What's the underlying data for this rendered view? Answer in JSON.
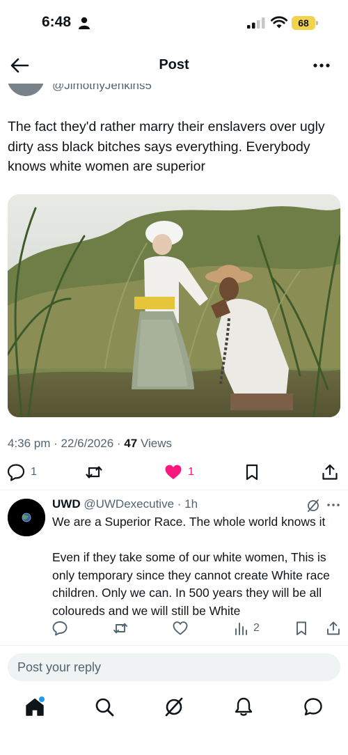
{
  "status_bar": {
    "time": "6:48",
    "battery": "68"
  },
  "header": {
    "title": "Post"
  },
  "post": {
    "author_handle_partial": "@JimothyJenkins5",
    "text": "The fact they'd rather marry their enslavers over ugly dirty ass black bitches says everything. Everybody knows white women are superior",
    "time": "4:36 pm",
    "date": "22/6/2026",
    "views_count": "47",
    "views_label": "Views",
    "replies": "1",
    "likes": "1",
    "liked": true
  },
  "reply": {
    "name": "UWD",
    "handle": "@UWDexecutive",
    "age": "1h",
    "text": "We are a Superior Race. The whole world knows it\n\nEven if they take some of our white women, This is only temporary since they cannot create White race children. Only we can. In 500 years they will be all coloureds and we will still be White",
    "views": "2"
  },
  "compose": {
    "placeholder": "Post your reply"
  },
  "tabbar": {
    "items": [
      {
        "name": "home",
        "icon": "home-icon",
        "active": true
      },
      {
        "name": "search",
        "icon": "search-icon"
      },
      {
        "name": "grok",
        "icon": "grok-icon"
      },
      {
        "name": "notifications",
        "icon": "bell-icon"
      },
      {
        "name": "messages",
        "icon": "message-icon"
      }
    ]
  },
  "colors": {
    "accent": "#1d9bf0",
    "like": "#f91880",
    "text": "#0f1419",
    "muted": "#536471",
    "battery": "#f2d34d"
  }
}
